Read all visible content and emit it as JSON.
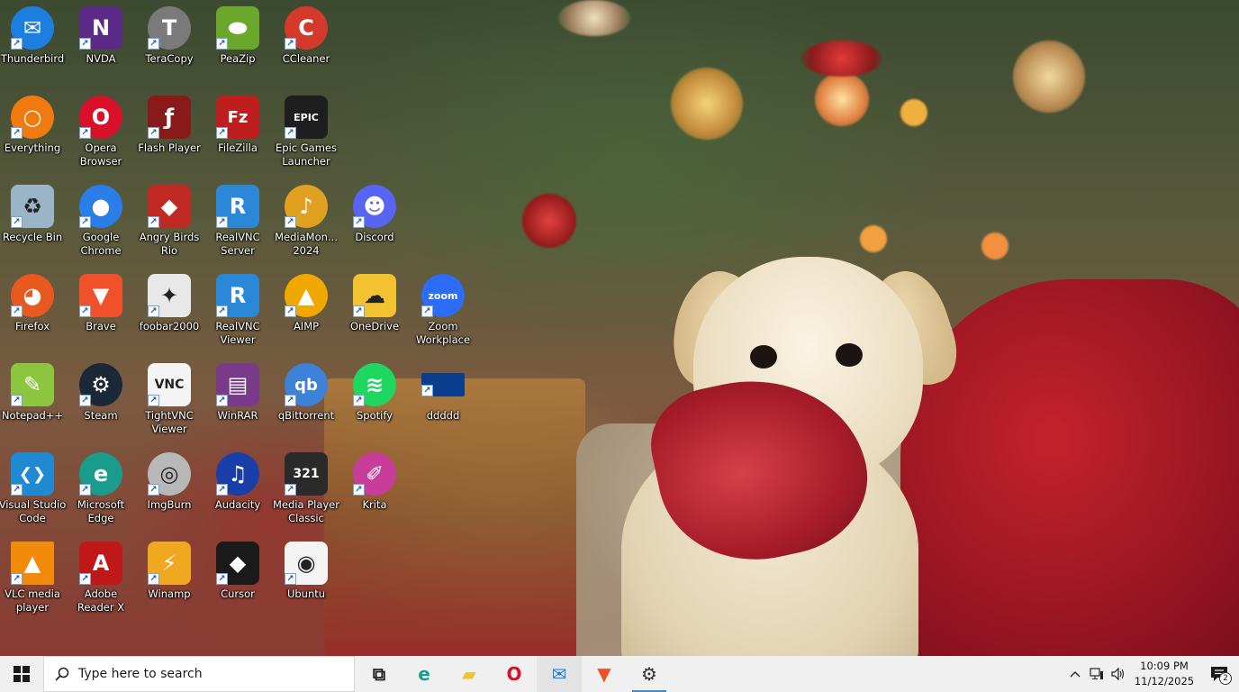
{
  "desktop": {
    "icons": [
      {
        "label": "Thunderbird",
        "icon": "thunderbird-icon",
        "color": "#1c7fe0",
        "glyph": "✉",
        "shape": "round"
      },
      {
        "label": "NVDA",
        "icon": "nvda-icon",
        "color": "#5b2a86",
        "glyph": "N",
        "shape": "square"
      },
      {
        "label": "TeraCopy",
        "icon": "teracopy-icon",
        "color": "#7a7a7a",
        "glyph": "T",
        "shape": "round"
      },
      {
        "label": "PeaZip",
        "icon": "peazip-icon",
        "color": "#6aa82c",
        "glyph": "⬬",
        "shape": "square"
      },
      {
        "label": "CCleaner",
        "icon": "ccleaner-icon",
        "color": "#d33a2c",
        "glyph": "C",
        "shape": "round"
      },
      {
        "label": "Everything",
        "icon": "everything-search-icon",
        "color": "#f07a10",
        "glyph": "○",
        "shape": "round"
      },
      {
        "label": "Opera Browser",
        "icon": "opera-icon",
        "color": "#d8102a",
        "glyph": "O",
        "shape": "round"
      },
      {
        "label": "Flash Player",
        "icon": "flash-player-icon",
        "color": "#8a1a1a",
        "glyph": "ƒ",
        "shape": "square"
      },
      {
        "label": "FileZilla",
        "icon": "filezilla-icon",
        "color": "#bf1e1e",
        "glyph": "Fz",
        "shape": "square"
      },
      {
        "label": "Epic Games Launcher",
        "icon": "epic-games-icon",
        "color": "#1e1e1e",
        "glyph": "EPIC",
        "shape": "square"
      },
      {
        "label": "Recycle Bin",
        "icon": "recycle-bin-icon",
        "color": "#9ab4c8",
        "glyph": "♻",
        "shape": "square"
      },
      {
        "label": "Google Chrome",
        "icon": "chrome-icon",
        "color": "#2b7de9",
        "glyph": "●",
        "shape": "round"
      },
      {
        "label": "Angry Birds Rio",
        "icon": "angry-birds-icon",
        "color": "#c02a22",
        "glyph": "◆",
        "shape": "square"
      },
      {
        "label": "RealVNC Server",
        "icon": "realvnc-server-icon",
        "color": "#2b88d8",
        "glyph": "R",
        "shape": "square"
      },
      {
        "label": "MediaMon... 2024",
        "icon": "mediamonkey-icon",
        "color": "#e0a020",
        "glyph": "♪",
        "shape": "round"
      },
      {
        "label": "Discord",
        "icon": "discord-icon",
        "color": "#5865f2",
        "glyph": "☻",
        "shape": "round"
      },
      {
        "label": "Firefox",
        "icon": "firefox-icon",
        "color": "#e8591f",
        "glyph": "◕",
        "shape": "round"
      },
      {
        "label": "Brave",
        "icon": "brave-icon",
        "color": "#f0512a",
        "glyph": "▼",
        "shape": "square"
      },
      {
        "label": "foobar2000",
        "icon": "foobar2000-icon",
        "color": "#e8e8e8",
        "glyph": "✦",
        "shape": "square"
      },
      {
        "label": "RealVNC Viewer",
        "icon": "realvnc-viewer-icon",
        "color": "#2b88d8",
        "glyph": "R",
        "shape": "square"
      },
      {
        "label": "AIMP",
        "icon": "aimp-icon",
        "color": "#f0a800",
        "glyph": "▲",
        "shape": "round"
      },
      {
        "label": "OneDrive",
        "icon": "onedrive-icon",
        "color": "#f2c230",
        "glyph": "☁",
        "shape": "square"
      },
      {
        "label": "Zoom Workplace",
        "icon": "zoom-icon",
        "color": "#2d6cf5",
        "glyph": "zoom",
        "shape": "round"
      },
      {
        "label": "Notepad++",
        "icon": "notepad-plus-plus-icon",
        "color": "#8cc63f",
        "glyph": "✎",
        "shape": "square"
      },
      {
        "label": "Steam",
        "icon": "steam-icon",
        "color": "#1b2838",
        "glyph": "⚙",
        "shape": "round"
      },
      {
        "label": "TightVNC Viewer",
        "icon": "tightvnc-icon",
        "color": "#f4f4f4",
        "glyph": "VNC",
        "shape": "square"
      },
      {
        "label": "WinRAR",
        "icon": "winrar-icon",
        "color": "#7a3a8c",
        "glyph": "▤",
        "shape": "square"
      },
      {
        "label": "qBittorrent",
        "icon": "qbittorrent-icon",
        "color": "#3c82d6",
        "glyph": "qb",
        "shape": "round"
      },
      {
        "label": "Spotify",
        "icon": "spotify-icon",
        "color": "#1ed760",
        "glyph": "≋",
        "shape": "round"
      },
      {
        "label": "ddddd",
        "icon": "image-file-icon",
        "color": "#0a3d8c",
        "glyph": "",
        "shape": "flat"
      },
      {
        "label": "Visual Studio Code",
        "icon": "vscode-icon",
        "color": "#1f8ad2",
        "glyph": "❮❯",
        "shape": "square"
      },
      {
        "label": "Microsoft Edge",
        "icon": "edge-icon",
        "color": "#1a9c8c",
        "glyph": "e",
        "shape": "round"
      },
      {
        "label": "ImgBurn",
        "icon": "imgburn-icon",
        "color": "#b8b8b8",
        "glyph": "◎",
        "shape": "round"
      },
      {
        "label": "Audacity",
        "icon": "audacity-icon",
        "color": "#1a3ea8",
        "glyph": "♫",
        "shape": "round"
      },
      {
        "label": "Media Player Classic",
        "icon": "media-player-classic-icon",
        "color": "#2a2a2a",
        "glyph": "321",
        "shape": "square"
      },
      {
        "label": "Krita",
        "icon": "krita-icon",
        "color": "#c83c9a",
        "glyph": "✐",
        "shape": "round"
      },
      {
        "label": "VLC media player",
        "icon": "vlc-icon",
        "color": "#f28a0c",
        "glyph": "▲",
        "shape": "flat"
      },
      {
        "label": "Adobe Reader X",
        "icon": "adobe-reader-icon",
        "color": "#c01818",
        "glyph": "A",
        "shape": "square"
      },
      {
        "label": "Winamp",
        "icon": "winamp-icon",
        "color": "#f0a820",
        "glyph": "⚡",
        "shape": "square"
      },
      {
        "label": "Cursor",
        "icon": "cursor-icon",
        "color": "#1a1a1a",
        "glyph": "◆",
        "shape": "square"
      },
      {
        "label": "Ubuntu",
        "icon": "ubuntu-file-icon",
        "color": "#f4f4f4",
        "glyph": "◉",
        "shape": "square"
      }
    ]
  },
  "taskbar": {
    "search_placeholder": "Type here to search",
    "pinned": [
      {
        "name": "task-view",
        "icon": "task-view-icon",
        "glyph": "⧉",
        "color": "#222222"
      },
      {
        "name": "edge",
        "icon": "edge-icon",
        "glyph": "e",
        "color": "#1a9c8c"
      },
      {
        "name": "file-explorer",
        "icon": "folder-icon",
        "glyph": "▰",
        "color": "#f2c230"
      },
      {
        "name": "opera",
        "icon": "opera-icon",
        "glyph": "O",
        "color": "#d8102a"
      },
      {
        "name": "thunderbird",
        "icon": "thunderbird-icon",
        "glyph": "✉",
        "color": "#1c7fe0"
      },
      {
        "name": "brave",
        "icon": "brave-icon",
        "glyph": "▼",
        "color": "#f0512a"
      },
      {
        "name": "settings",
        "icon": "gear-icon",
        "glyph": "⚙",
        "color": "#333333"
      }
    ],
    "time": "10:09 PM",
    "date": "11/12/2025",
    "notification_count": "2"
  }
}
